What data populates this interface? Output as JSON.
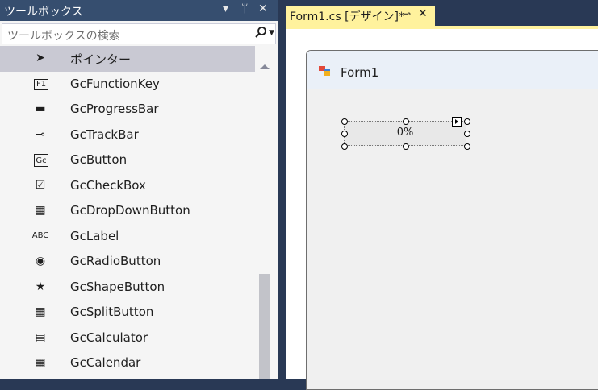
{
  "toolbox": {
    "title": "ツールボックス",
    "controls": {
      "dropdown": "▾",
      "pin": "ᛘ",
      "close": "✕"
    },
    "search": {
      "placeholder": "ツールボックスの検索",
      "icon": "search-icon"
    },
    "items": [
      {
        "label": "ポインター",
        "icon": "pointer-icon",
        "glyph": "➤",
        "selected": true
      },
      {
        "label": "GcFunctionKey",
        "icon": "function-key-icon",
        "glyph": "F1"
      },
      {
        "label": "GcProgressBar",
        "icon": "progress-bar-icon",
        "glyph": "▬"
      },
      {
        "label": "GcTrackBar",
        "icon": "track-bar-icon",
        "glyph": "⊸"
      },
      {
        "label": "GcButton",
        "icon": "button-icon",
        "glyph": "Gc"
      },
      {
        "label": "GcCheckBox",
        "icon": "checkbox-icon",
        "glyph": "☑"
      },
      {
        "label": "GcDropDownButton",
        "icon": "dropdown-button-icon",
        "glyph": "▦"
      },
      {
        "label": "GcLabel",
        "icon": "label-icon",
        "glyph": "ABC"
      },
      {
        "label": "GcRadioButton",
        "icon": "radio-button-icon",
        "glyph": "◉"
      },
      {
        "label": "GcShapeButton",
        "icon": "shape-button-icon",
        "glyph": "★"
      },
      {
        "label": "GcSplitButton",
        "icon": "split-button-icon",
        "glyph": "▦"
      },
      {
        "label": "GcCalculator",
        "icon": "calculator-icon",
        "glyph": "▤"
      },
      {
        "label": "GcCalendar",
        "icon": "calendar-icon",
        "glyph": "▦"
      }
    ]
  },
  "document": {
    "tab_label": "Form1.cs [デザイン]*",
    "tab_pin": "⊸",
    "tab_close": "✕"
  },
  "form": {
    "title": "Form1",
    "progress_text": "0%"
  },
  "colors": {
    "accent_tab": "#fff29d",
    "toolbox_title": "#364e6f",
    "ide_background": "#293955"
  }
}
